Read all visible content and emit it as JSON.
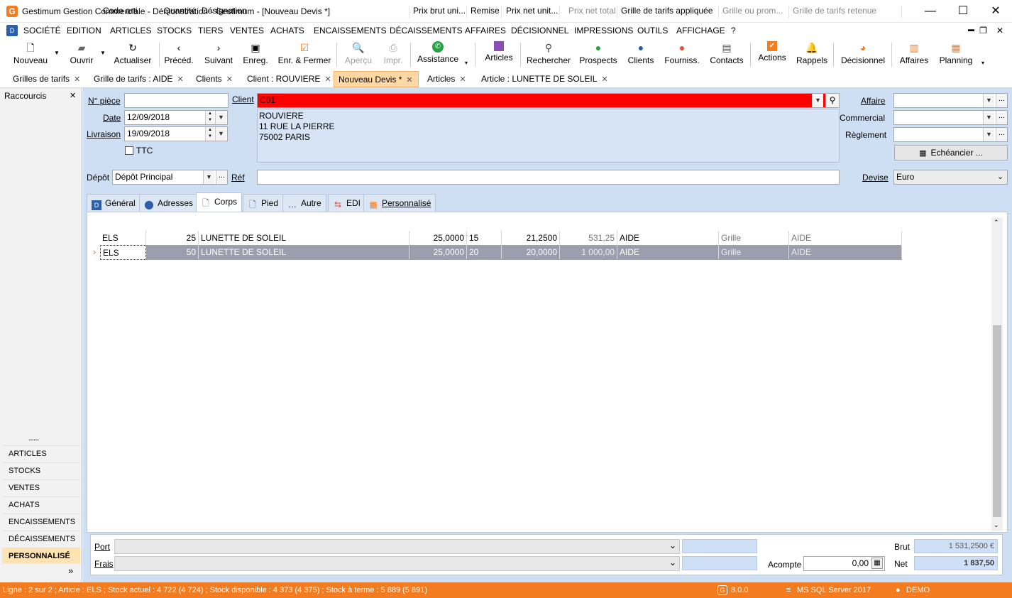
{
  "window": {
    "title": "Gestimum Gestion Commerciale - Démonstration - Gestimum - [Nouveau Devis *]",
    "app_icon": "G",
    "minimize": "—",
    "maximize": "☐",
    "close": "✕"
  },
  "menu": {
    "icon": "D",
    "items": [
      "SOCIÉTÉ",
      "EDITION",
      "ARTICLES",
      "STOCKS",
      "TIERS",
      "VENTES",
      "ACHATS",
      "ENCAISSEMENTS",
      "DÉCAISSEMENTS",
      "AFFAIRES",
      "DÉCISIONNEL",
      "IMPRESSIONS",
      "OUTILS",
      "AFFICHAGE",
      "?"
    ],
    "win_controls": [
      "▬",
      "❐",
      "✕"
    ]
  },
  "toolbar": {
    "nouveau": "Nouveau",
    "ouvrir": "Ouvrir",
    "actualiser": "Actualiser",
    "preced": "Précéd.",
    "suivant": "Suivant",
    "enreg": "Enreg.",
    "enr_fermer": "Enr. & Fermer",
    "apercu": "Aperçu",
    "impr": "Impr.",
    "assistance": "Assistance",
    "articles": "Articles",
    "rechercher": "Rechercher",
    "prospects": "Prospects",
    "clients": "Clients",
    "fourniss": "Fourniss.",
    "contacts": "Contacts",
    "actions": "Actions",
    "rappels": "Rappels",
    "decisionnel": "Décisionnel",
    "affaires": "Affaires",
    "planning": "Planning"
  },
  "doc_tabs": [
    "Grilles de tarifs",
    "Grille de tarifs : AIDE",
    "Clients",
    "Client : ROUVIERE",
    "Nouveau Devis *",
    "Articles",
    "Article : LUNETTE DE SOLEIL"
  ],
  "left_panel": {
    "title": "Raccourcis",
    "dots": "........",
    "items": [
      "ARTICLES",
      "STOCKS",
      "VENTES",
      "ACHATS",
      "ENCAISSEMENTS",
      "DÉCAISSEMENTS",
      "PERSONNALISÉ"
    ],
    "more": "»"
  },
  "form": {
    "npiece_label": "N° pièce",
    "npiece_value": "",
    "date_label": "Date",
    "date_value": "12/09/2018",
    "livraison_label": "Livraison",
    "livraison_value": "19/09/2018",
    "ttc_label": "TTC",
    "client_label": "Client",
    "client_value": "C01",
    "address": [
      "ROUVIERE",
      "11 RUE LA PIERRE",
      "75002 PARIS"
    ],
    "affaire_label": "Affaire",
    "commercial_label": "Commercial",
    "reglement_label": "Règlement",
    "echeancier_label": "Echéancier ...",
    "depot_label": "Dépôt",
    "depot_value": "Dépôt Principal",
    "ref_label": "Réf",
    "ref_value": "",
    "devise_label": "Devise",
    "devise_value": "Euro"
  },
  "inner_tabs": [
    "Général",
    "Adresses",
    "Corps",
    "Pied",
    "Autre",
    "EDI",
    "Personnalisé"
  ],
  "grid": {
    "columns": [
      "Code arti",
      "Quantité",
      "Désignation",
      "Prix brut uni...",
      "Remise",
      "Prix net unit...",
      "Prix net total",
      "Grille de tarifs appliquée",
      "Grille ou prom...",
      "Grille de tarifs retenue"
    ],
    "rows": [
      [
        "ELS",
        "25",
        "LUNETTE DE SOLEIL",
        "25,0000",
        "15",
        "21,2500",
        "531,25",
        "AIDE",
        "Grille",
        "AIDE"
      ],
      [
        "ELS",
        "50",
        "LUNETTE DE SOLEIL",
        "25,0000",
        "20",
        "20,0000",
        "1 000,00",
        "AIDE",
        "Grille",
        "AIDE"
      ]
    ],
    "row_marker": "›"
  },
  "footer": {
    "port_label": "Port",
    "frais_label": "Frais",
    "acompte_label": "Acompte",
    "acompte_value": "0,00",
    "brut_label": "Brut",
    "brut_value": "1 531,2500 €",
    "net_label": "Net",
    "net_value": "1 837,50"
  },
  "status": {
    "text": "Ligne : 2 sur 2 ; Article : ELS ; Stock actuel : 4 722 (4 724) ; Stock disponible : 4 373 (4 375) ; Stock à terme : 5 889 (5 891)",
    "version": "8.0.0",
    "db": "MS SQL Server 2017",
    "user": "DEMO"
  },
  "colors": {
    "accent": "#f47c20",
    "form_bg": "#cfdff3",
    "client_field": "#ff0000",
    "selected_row": "#9b9fad"
  }
}
